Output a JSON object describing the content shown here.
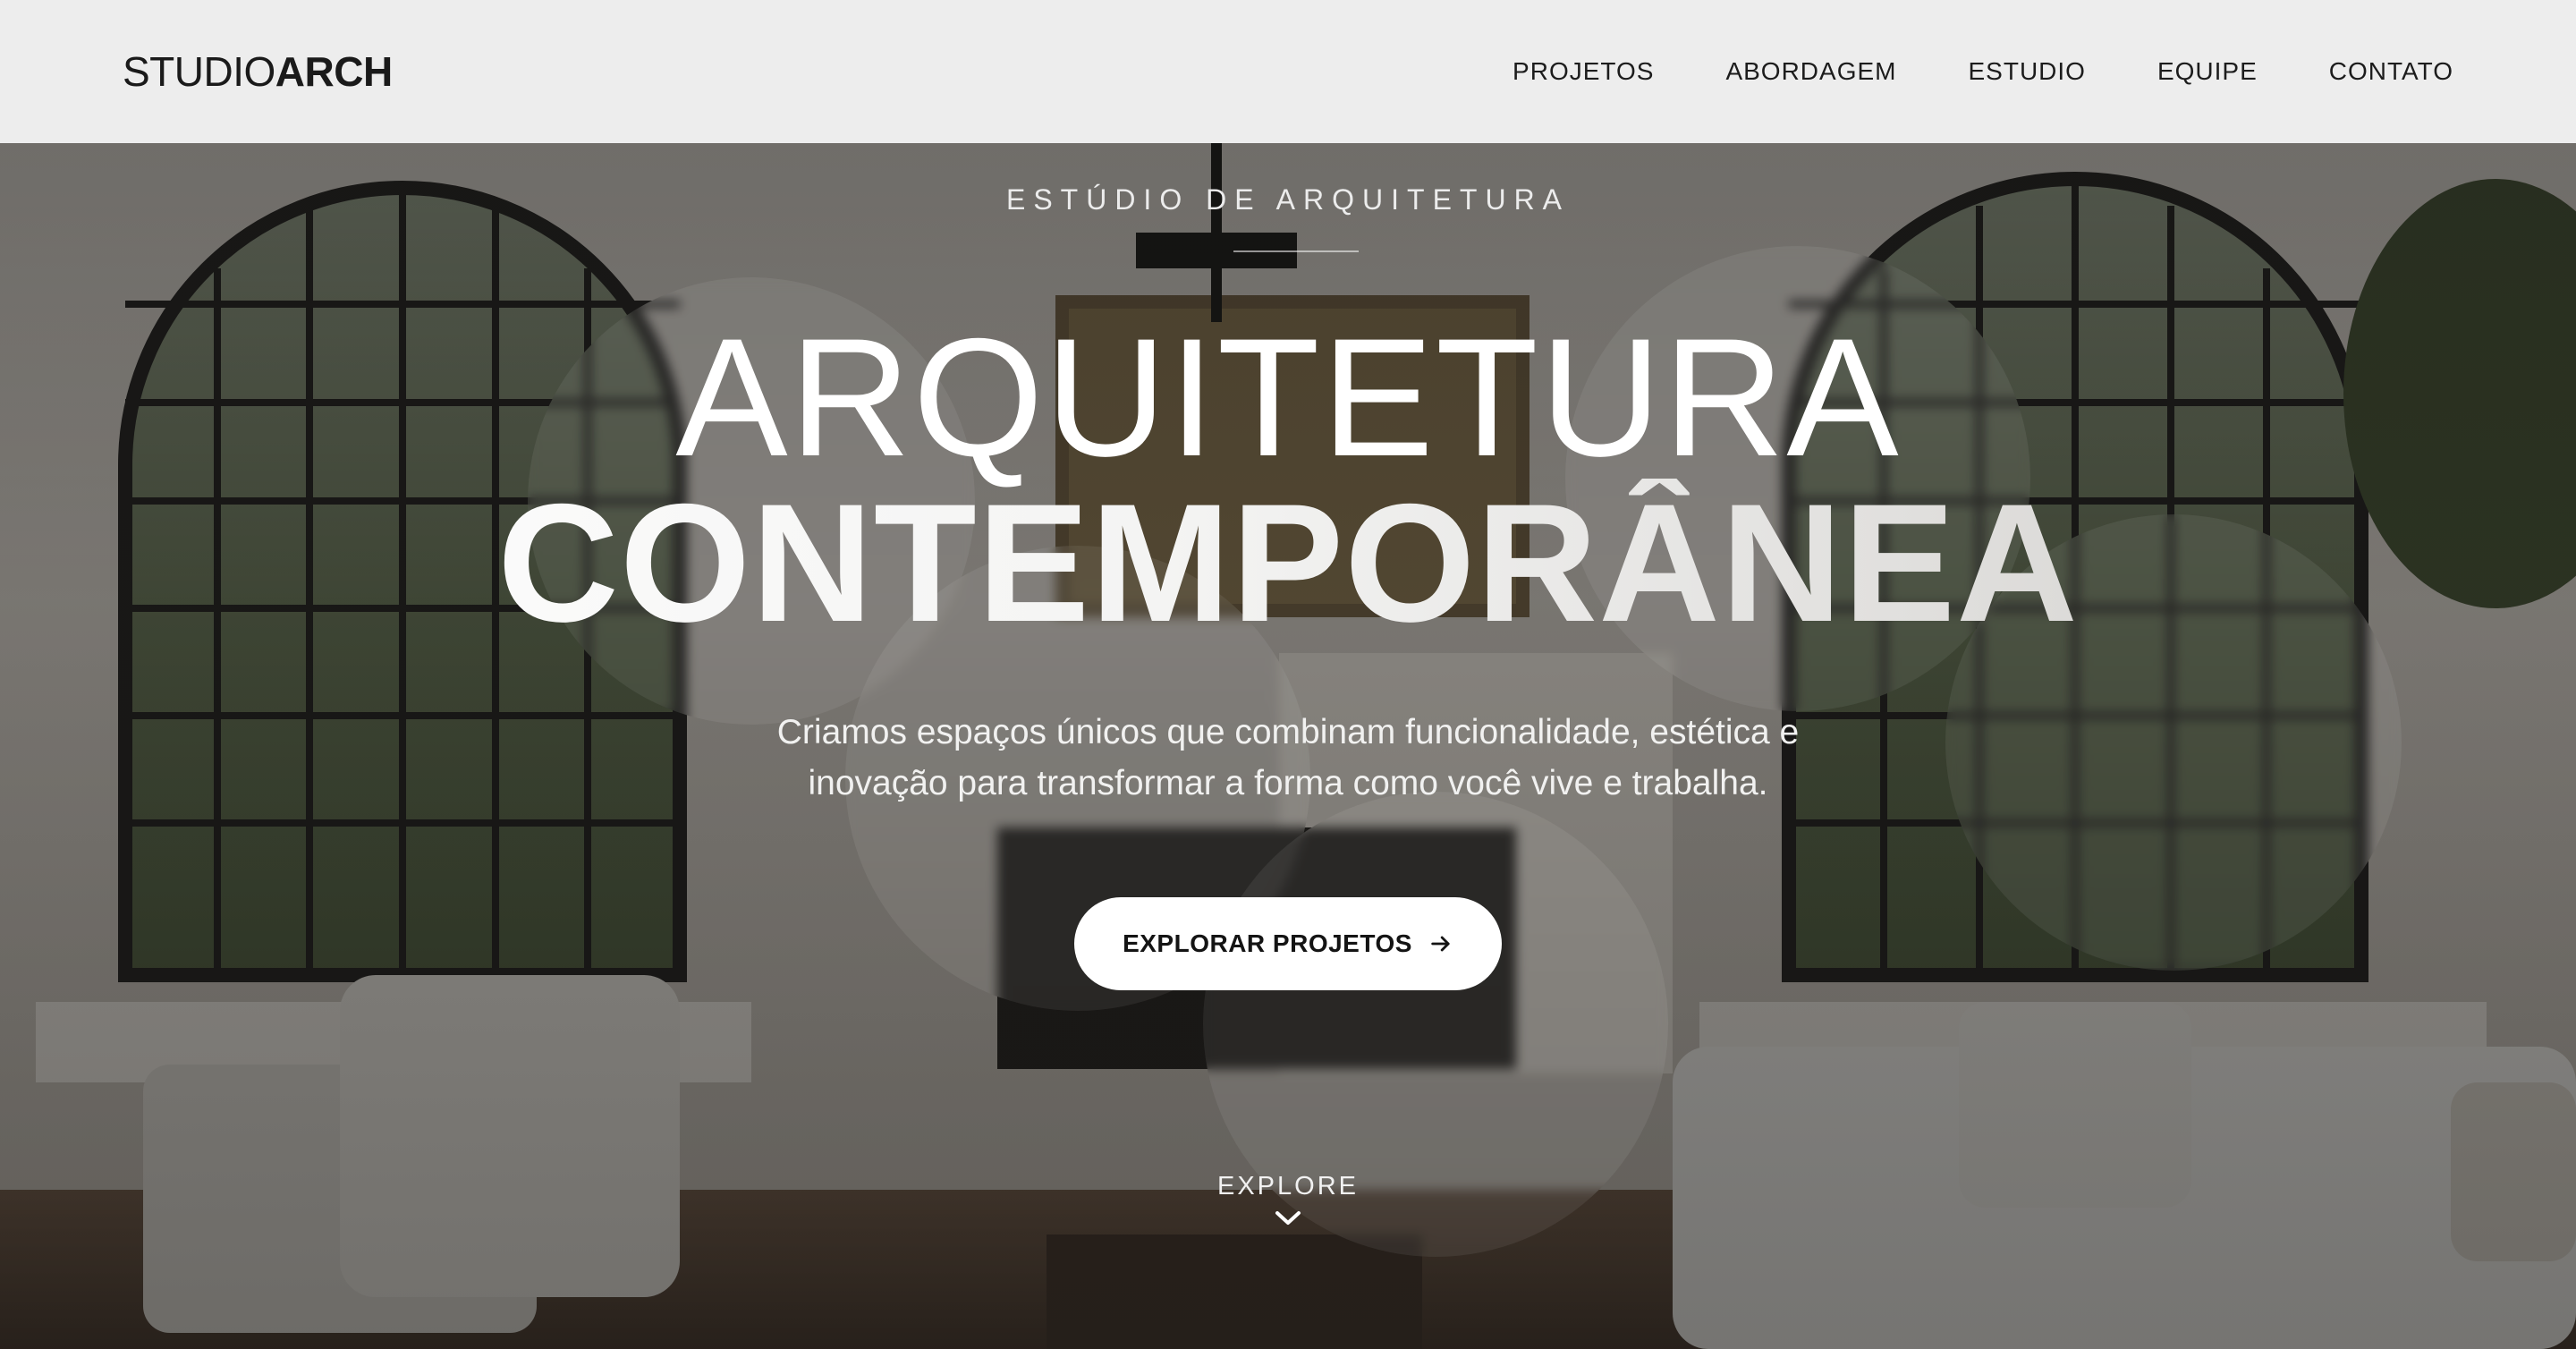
{
  "header": {
    "logo_light": "STUDIO",
    "logo_bold": "ARCH",
    "nav": [
      {
        "label": "PROJETOS"
      },
      {
        "label": "ABORDAGEM"
      },
      {
        "label": "ESTUDIO"
      },
      {
        "label": "EQUIPE"
      },
      {
        "label": "CONTATO"
      }
    ]
  },
  "hero": {
    "eyebrow": "ESTÚDIO DE ARQUITETURA",
    "headline_line1": "ARQUITETURA",
    "headline_line2": "CONTEMPORÂNEA",
    "subtitle_line1": "Criamos espaços únicos que combinam funcionalidade, estética e",
    "subtitle_line2": "inovação para transformar a forma como você vive e trabalha.",
    "cta_label": "EXPLORAR PROJETOS",
    "cta_icon": "arrow-right-icon",
    "explore_label": "EXPLORE",
    "explore_icon": "chevron-down-icon"
  },
  "colors": {
    "header_bg": "#f3f3f2",
    "text_dark": "#1a1a1a",
    "hero_text": "#ffffff",
    "cta_bg": "#ffffff"
  }
}
